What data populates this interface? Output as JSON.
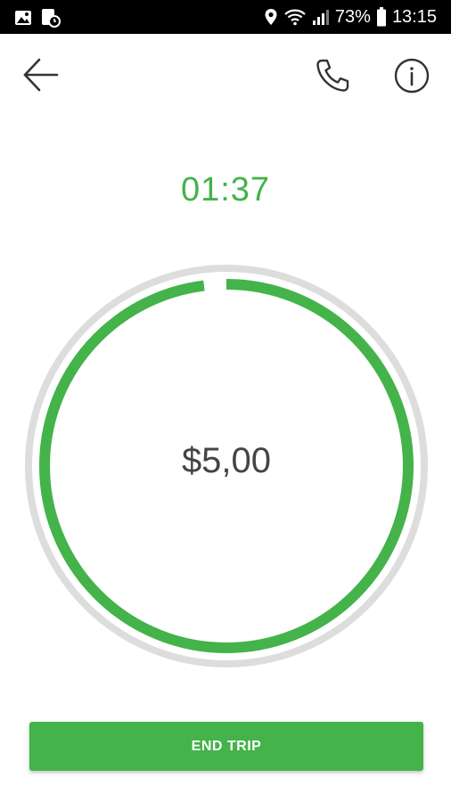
{
  "status_bar": {
    "battery_percent": "73%",
    "time": "13:15",
    "icons": [
      "image-icon",
      "timer-notification-icon",
      "location-icon",
      "wifi-icon",
      "signal-icon",
      "battery-icon"
    ]
  },
  "header": {
    "back_icon": "arrow-left-icon",
    "call_icon": "phone-icon",
    "info_icon": "info-icon"
  },
  "trip": {
    "elapsed": "01:37",
    "fare": "$5,00",
    "progress": 0.98
  },
  "actions": {
    "end_trip_label": "END TRIP"
  },
  "colors": {
    "accent": "#43b34a",
    "track": "#dddddd",
    "status_bar": "#000000"
  }
}
